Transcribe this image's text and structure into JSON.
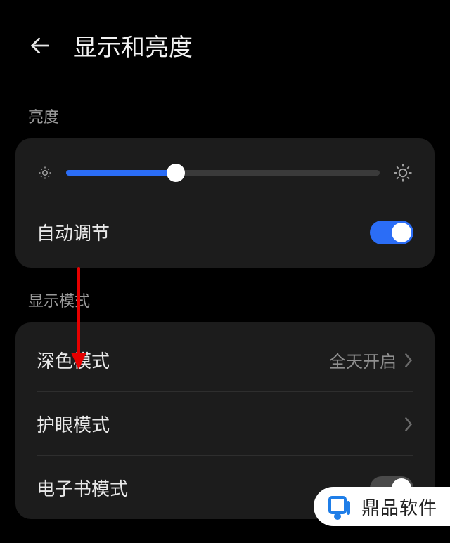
{
  "header": {
    "title": "显示和亮度"
  },
  "sections": {
    "brightness_label": "亮度",
    "display_mode_label": "显示模式"
  },
  "brightness": {
    "value_percent": 35,
    "auto_adjust_label": "自动调节",
    "auto_adjust_on": true
  },
  "display_mode": {
    "dark_mode_label": "深色模式",
    "dark_mode_value": "全天开启",
    "eye_comfort_label": "护眼模式",
    "ebook_mode_label": "电子书模式",
    "ebook_mode_on": false
  },
  "watermark": {
    "text": "鼎品软件"
  }
}
